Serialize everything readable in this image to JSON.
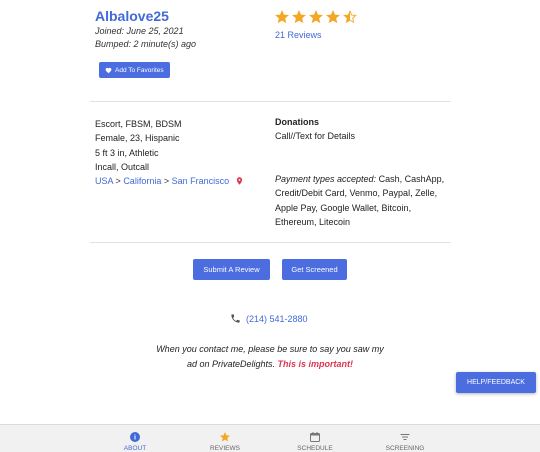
{
  "profile": {
    "name": "Albalove25",
    "joined": "Joined: June 25, 2021",
    "bumped": "Bumped: 2 minute(s) ago",
    "favorites_button": "Add To Favorites",
    "rating": 4.5,
    "rating_max": 5,
    "reviews_link": "21 Reviews"
  },
  "details": {
    "line1": "Escort, FBSM, BDSM",
    "line2": "Female, 23, Hispanic",
    "line3": "5 ft 3 in, Athletic",
    "line4": "Incall, Outcall",
    "country": "USA",
    "state": "California",
    "city": "San Francisco",
    "separator": ">"
  },
  "donations": {
    "title": "Donations",
    "text": "Call//Text for Details",
    "payment_label": "Payment types accepted:",
    "payment_types": "Cash, CashApp, Credit/Debit Card, Venmo, Paypal, Zelle, Apple Pay, Google Wallet, Bitcoin, Ethereum, Litecoin"
  },
  "actions": {
    "submit_review": "Submit A Review",
    "get_screened": "Get Screened"
  },
  "contact": {
    "phone": "(214) 541-2880",
    "message": "When you contact me, please be sure to say you saw my ad on PrivateDelights.",
    "important": "This is important!"
  },
  "help_button": "HELP/FEEDBACK",
  "colors": {
    "accent": "#4b6de0",
    "link": "#4169d8",
    "star": "#f5a623",
    "important": "#e0344f",
    "pin": "#e0344f"
  },
  "bottom_nav": {
    "items": [
      {
        "label": "ABOUT",
        "icon": "info-icon",
        "active": true
      },
      {
        "label": "REVIEWS",
        "icon": "star-icon",
        "active": false
      },
      {
        "label": "SCHEDULE",
        "icon": "calendar-icon",
        "active": false
      },
      {
        "label": "SCREENING",
        "icon": "filter-icon",
        "active": false
      }
    ]
  }
}
